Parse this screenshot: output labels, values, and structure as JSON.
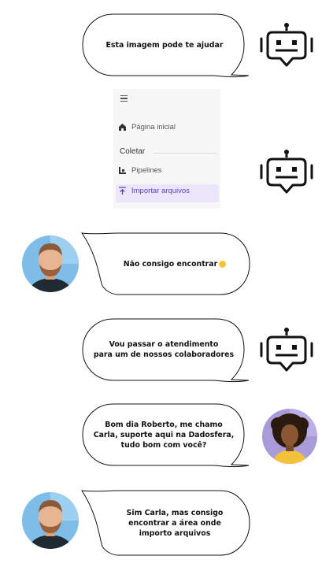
{
  "messages": [
    {
      "text": "Esta imagem pode te ajudar"
    },
    {
      "text": "Não consigo encontrar"
    },
    {
      "text_line1": "Vou passar o atendimento",
      "text_line2": "para um de nossos colaboradores"
    },
    {
      "text_line1": "Bom dia Roberto, me chamo",
      "text_line2": "Carla, suporte aqui na Dadosfera,",
      "text_line3": "tudo bom com você?"
    },
    {
      "text_line1": "Sim Carla, mas consigo",
      "text_line2": "encontrar a área onde",
      "text_line3": "importo arquivos"
    }
  ],
  "screenshot": {
    "home_label": "Página inicial",
    "section_label": "Coletar",
    "pipelines_label": "Pipelines",
    "import_label": "Importar arquivos",
    "accent_color": "#5b3fc4",
    "active_bg": "#ece6fa"
  },
  "icons": {
    "bot": "robot-icon",
    "user": "roberto-avatar",
    "agent": "carla-avatar",
    "emoji": "smile-emoji-icon"
  }
}
